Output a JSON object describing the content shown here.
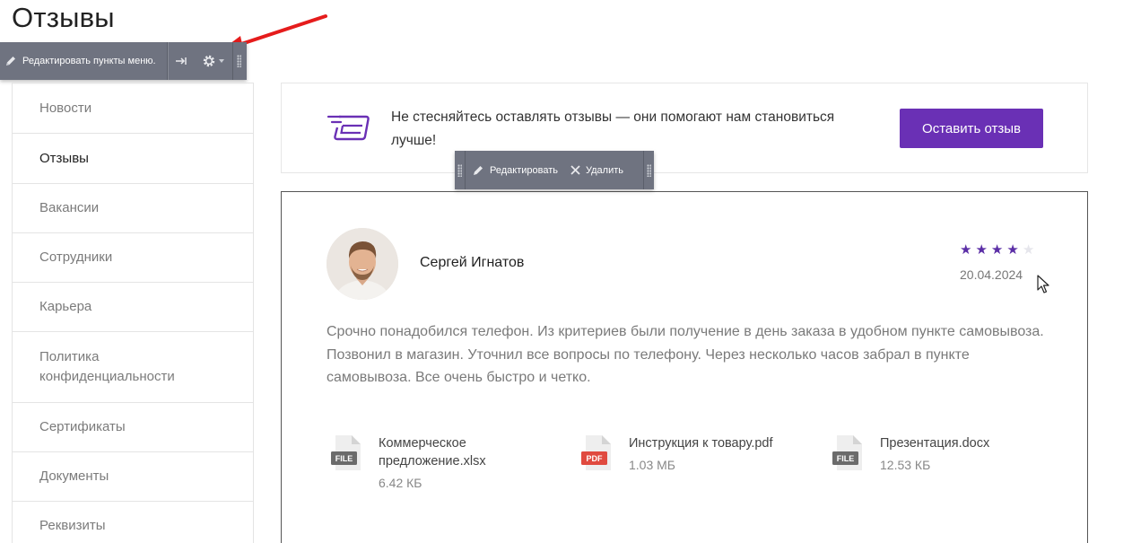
{
  "page": {
    "title": "Отзывы"
  },
  "menu_toolbar": {
    "edit_label": "Редактировать пункты меню."
  },
  "sidebar": {
    "items": [
      {
        "label": "Новости",
        "active": false
      },
      {
        "label": "Отзывы",
        "active": true
      },
      {
        "label": "Вакансии",
        "active": false
      },
      {
        "label": "Сотрудники",
        "active": false
      },
      {
        "label": "Карьера",
        "active": false
      },
      {
        "label": "Политика конфиденциальности",
        "active": false
      },
      {
        "label": "Сертификаты",
        "active": false
      },
      {
        "label": "Документы",
        "active": false
      },
      {
        "label": "Реквизиты",
        "active": false
      }
    ]
  },
  "cta": {
    "text": "Не стесняйтесь оставлять отзывы — они помогают нам становиться лучше!",
    "button_label": "Оставить отзыв"
  },
  "review_toolbar": {
    "edit_label": "Редактировать",
    "delete_label": "Удалить"
  },
  "review": {
    "author": "Сергей Игнатов",
    "rating": 4,
    "rating_max": 5,
    "date": "20.04.2024",
    "text": "Срочно понадобился телефон. Из критериев были получение в день заказа в удобном пункте самовывоза. Позвонил в магазин. Уточнил все вопросы по телефону. Через несколько часов забрал в пункте самовывоза. Все очень быстро и четко.",
    "files": [
      {
        "name": "Коммерческое предложение.xlsx",
        "size": "6.42 КБ",
        "badge": "FILE"
      },
      {
        "name": "Инструкция к товару.pdf",
        "size": "1.03 МБ",
        "badge": "PDF"
      },
      {
        "name": "Презентация.docx",
        "size": "12.53 КБ",
        "badge": "FILE"
      }
    ]
  },
  "colors": {
    "accent": "#6a30b5",
    "star_filled": "#5b2ea6",
    "star_empty": "#e6e6ec",
    "toolbar": "#6f7380",
    "pdf_badge": "#e04a3f",
    "file_badge": "#6b6b6b"
  }
}
